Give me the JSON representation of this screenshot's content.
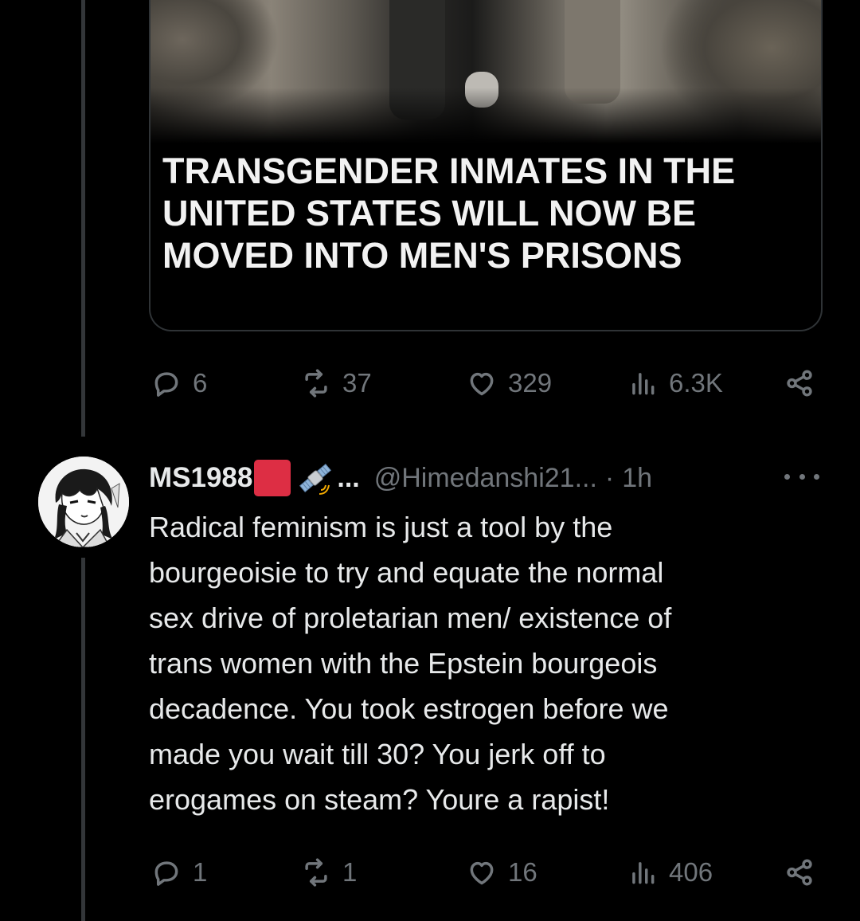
{
  "first_tweet": {
    "media_headline": "TRANSGENDER INMATES IN THE\nUNITED STATES WILL NOW BE\nMOVED INTO MEN'S PRISONS",
    "actions": {
      "replies": "6",
      "reposts": "37",
      "likes": "329",
      "views": "6.3K"
    }
  },
  "reply_tweet": {
    "display_name": "MS1988",
    "name_emojis": [
      "red-square",
      "satellite"
    ],
    "name_truncation": "...",
    "handle": "@Himedanshi21...",
    "separator": "·",
    "time": "1h",
    "text": "Radical feminism is just a tool by the\nbourgeoisie to try and equate the normal\nsex drive of proletarian men/ existence of\ntrans women with the Epstein bourgeois\ndecadence. You took estrogen before we\nmade you wait till 30? You jerk off to\nerogames on steam? Youre a rapist!",
    "actions": {
      "replies": "1",
      "reposts": "1",
      "likes": "16",
      "views": "406"
    }
  },
  "colors": {
    "background": "#000000",
    "text_primary": "#e7e9ea",
    "text_secondary": "#71767b",
    "border": "#2f3336",
    "thread_line": "#333639",
    "red_square_emoji": "#dd2e44"
  },
  "icons": [
    "reply-icon",
    "repost-icon",
    "like-icon",
    "views-icon",
    "share-icon",
    "more-icon"
  ]
}
